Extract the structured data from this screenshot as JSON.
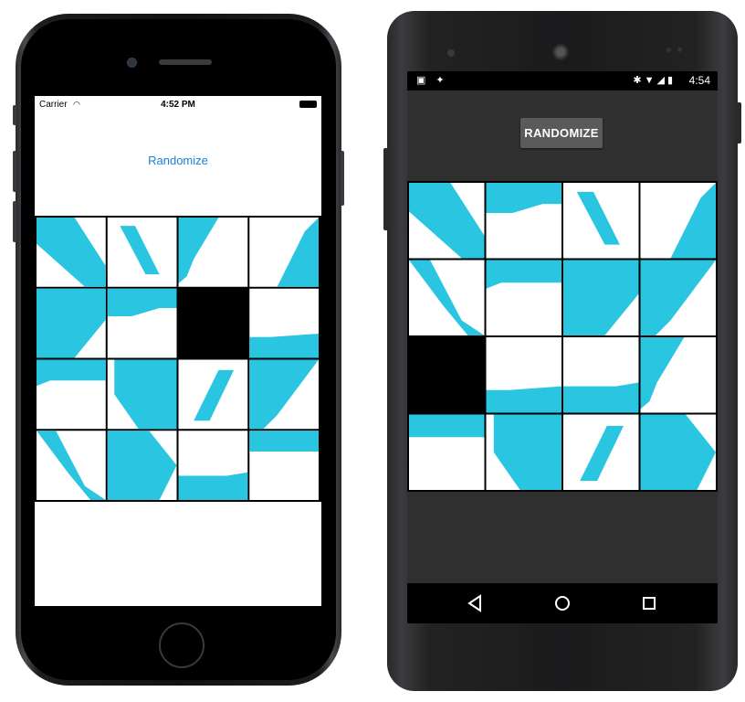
{
  "ios": {
    "status": {
      "carrier": "Carrier",
      "time": "4:52 PM"
    },
    "randomize_label": "Randomize",
    "board": [
      [
        {
          "t": "LL"
        },
        {
          "t": "RD"
        },
        {
          "t": "LA"
        },
        {
          "t": "RB"
        }
      ],
      [
        {
          "t": "LC"
        },
        {
          "t": "BR"
        },
        {
          "t": "EMPTY"
        },
        {
          "t": "BL"
        }
      ],
      [
        {
          "t": "BAR"
        },
        {
          "t": "NOTCH"
        },
        {
          "t": "LD"
        },
        {
          "t": "MR"
        }
      ],
      [
        {
          "t": "RC"
        },
        {
          "t": "HB"
        },
        {
          "t": "BAR2"
        },
        {
          "t": "BK"
        }
      ]
    ]
  },
  "android": {
    "status": {
      "time": "4:54"
    },
    "randomize_label": "RANDOMIZE",
    "board": [
      [
        {
          "t": "LL"
        },
        {
          "t": "BR"
        },
        {
          "t": "RD"
        },
        {
          "t": "RB"
        }
      ],
      [
        {
          "t": "RC"
        },
        {
          "t": "BAR"
        },
        {
          "t": "LC"
        },
        {
          "t": "MR"
        }
      ],
      [
        {
          "t": "EMPTY"
        },
        {
          "t": "BL"
        },
        {
          "t": "BAR2"
        },
        {
          "t": "LA"
        }
      ],
      [
        {
          "t": "BK"
        },
        {
          "t": "NOTCH"
        },
        {
          "t": "LD"
        },
        {
          "t": "HB"
        }
      ]
    ],
    "nav": {
      "back": "back-icon",
      "home": "home-icon",
      "recents": "recents-icon"
    }
  },
  "colors": {
    "tile": "#29c5e1",
    "tile_bg": "#ffffff",
    "empty": "#000000",
    "ios_link": "#1a7fd6",
    "android_button": "#5a5a5a"
  }
}
